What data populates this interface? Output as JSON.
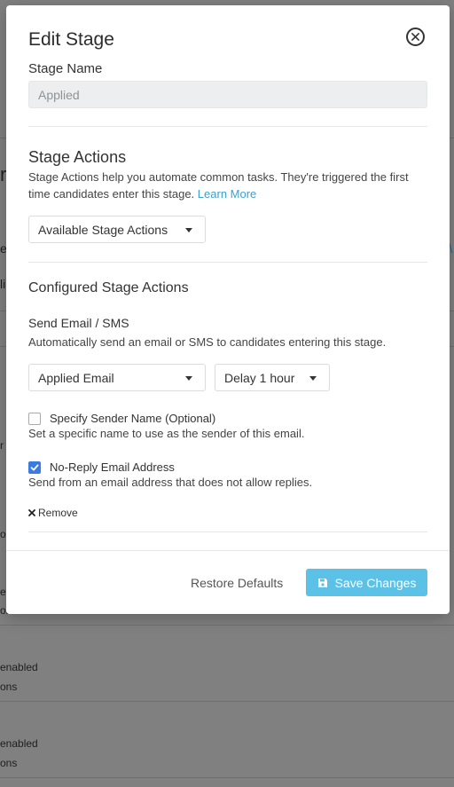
{
  "modal": {
    "title": "Edit Stage",
    "stage_name_label": "Stage Name",
    "stage_name_value": "Applied",
    "stage_actions": {
      "title": "Stage Actions",
      "description": "Stage Actions help you automate common tasks. They're triggered the first time candidates enter this stage.",
      "learn_more": "Learn More",
      "dropdown": "Available Stage Actions"
    },
    "configured": {
      "title": "Configured Stage Actions",
      "action_title": "Send Email / SMS",
      "action_description": "Automatically send an email or SMS to candidates entering this stage.",
      "template_dropdown": "Applied Email",
      "delay_dropdown": "Delay 1 hour",
      "sender_name": {
        "label": "Specify Sender Name (Optional)",
        "description": "Set a specific name to use as the sender of this email.",
        "checked": false
      },
      "no_reply": {
        "label": "No-Reply Email Address",
        "description": "Send from an email address that does not allow replies.",
        "checked": true
      },
      "remove": "Remove"
    },
    "footer": {
      "restore": "Restore Defaults",
      "save": "Save Changes"
    }
  },
  "background": {
    "fragments": [
      "r",
      "e",
      "li",
      "r",
      "on",
      "e",
      "on",
      "enabled",
      "ons",
      "enabled",
      "ons"
    ]
  },
  "colors": {
    "accent": "#5bc1e6",
    "link": "#3aa1d0",
    "checkbox": "#3b7be0"
  }
}
